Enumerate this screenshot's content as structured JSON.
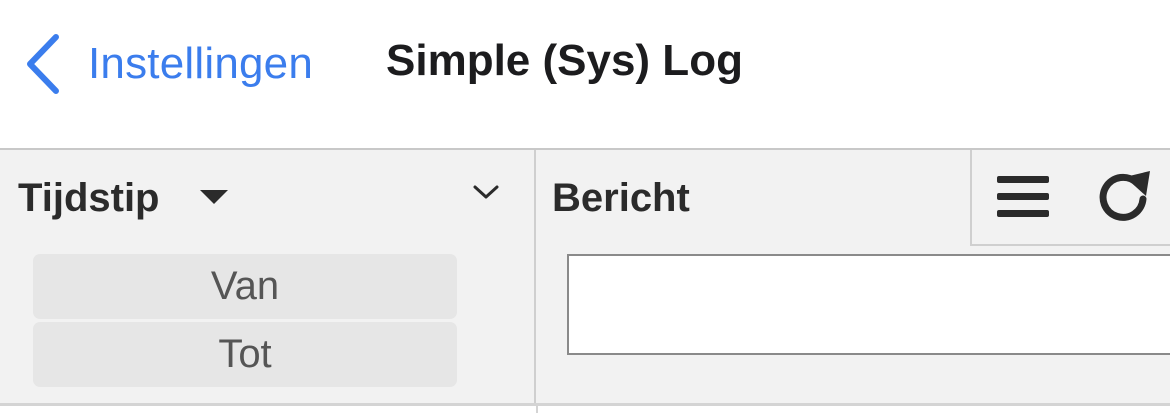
{
  "nav": {
    "back_label": "Instellingen",
    "title": "Simple (Sys) Log",
    "back_icon": "chevron-left-icon"
  },
  "grid": {
    "columns": [
      {
        "title": "Tijdstip",
        "sort": "descending",
        "filters": [
          {
            "label": "Van"
          },
          {
            "label": "Tot"
          }
        ]
      },
      {
        "title": "Bericht",
        "filter_value": ""
      }
    ],
    "toolbar": {
      "menu_icon": "hamburger-menu-icon",
      "refresh_icon": "refresh-icon"
    }
  },
  "colors": {
    "accent": "#3b7ded",
    "header_bg": "#f2f2f2",
    "filter_btn_bg": "#e6e6e6",
    "text_dark": "#1c1c1e"
  }
}
